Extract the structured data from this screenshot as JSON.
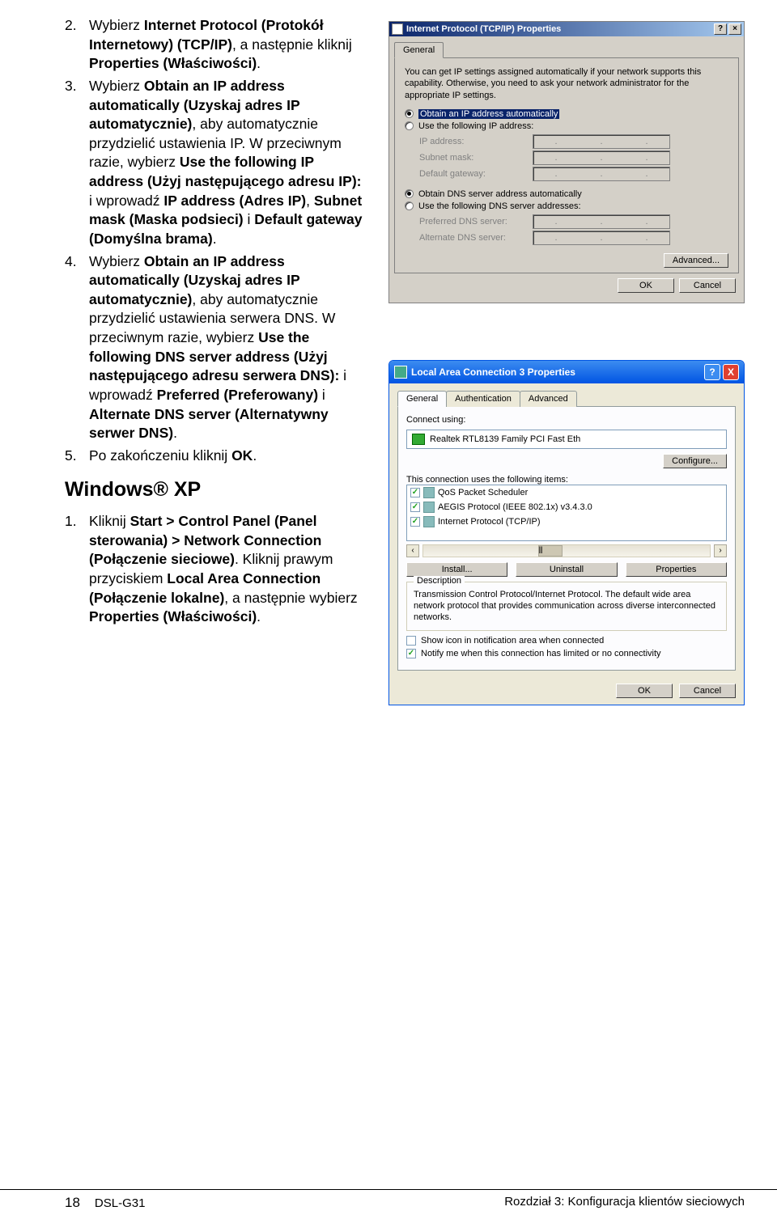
{
  "list1": {
    "item2": {
      "t1": "Wybierz ",
      "b1": "Internet Protocol (Protokół Internetowy) (TCP/IP)",
      "t2": ", a następnie kliknij ",
      "b2": "Properties (Właściwości)",
      "t3": "."
    },
    "item3": {
      "t1": "Wybierz ",
      "b1": "Obtain an IP address automatically (Uzyskaj adres IP automatycznie)",
      "t2": ", aby automatycznie przydzielić ustawienia IP. W przeciwnym razie, wybierz ",
      "b2": "Use the following IP address (Użyj następującego adresu IP):",
      "t3": " i wprowadź ",
      "b3": "IP address (Adres IP)",
      "t4": ", ",
      "b4": "Subnet mask (Maska podsieci)",
      "t5": " i ",
      "b5": "Default gateway (Domyślna brama)",
      "t6": "."
    },
    "item4": {
      "t1": "Wybierz ",
      "b1": "Obtain an IP address automatically (Uzyskaj adres IP automatycznie)",
      "t2": ", aby automatycznie przydzielić ustawienia serwera DNS. W przeciwnym razie, wybierz ",
      "b2": "Use the following DNS server address (Użyj następującego adresu serwera DNS):",
      "t3": " i wprowadź ",
      "b3": "Preferred (Preferowany)",
      "t4": " i ",
      "b4": "Alternate DNS server (Alternatywny serwer DNS)",
      "t5": "."
    },
    "item5": {
      "t1": "Po zakończeniu kliknij ",
      "b1": "OK",
      "t2": "."
    }
  },
  "header2": "Windows® XP",
  "list2": {
    "item1": {
      "t1": "Kliknij ",
      "b1": "Start > Control Panel (Panel sterowania) > Network Connection (Połączenie sieciowe)",
      "t2": ". Kliknij prawym przyciskiem ",
      "b2": "Local Area Connection (Połączenie lokalne)",
      "t3": ", a następnie wybierz ",
      "b3": "Properties (Właściwości)",
      "t4": "."
    }
  },
  "dlg1": {
    "title": "Internet Protocol (TCP/IP) Properties",
    "help": "?",
    "close": "×",
    "tab_general": "General",
    "intro": "You can get IP settings assigned automatically if your network supports this capability. Otherwise, you need to ask your network administrator for the appropriate IP settings.",
    "r1": "Obtain an IP address automatically",
    "r2": "Use the following IP address:",
    "f_ip": "IP address:",
    "f_subnet": "Subnet mask:",
    "f_gateway": "Default gateway:",
    "r3": "Obtain DNS server address automatically",
    "r4": "Use the following DNS server addresses:",
    "f_pref": "Preferred DNS server:",
    "f_alt": "Alternate DNS server:",
    "advanced": "Advanced...",
    "ok": "OK",
    "cancel": "Cancel"
  },
  "dlg2": {
    "title": "Local Area Connection 3 Properties",
    "help": "?",
    "close": "X",
    "tab_general": "General",
    "tab_auth": "Authentication",
    "tab_adv": "Advanced",
    "connect_using": "Connect using:",
    "nic": "Realtek RTL8139 Family PCI Fast Eth",
    "configure": "Configure...",
    "uses_items": "This connection uses the following items:",
    "it1": "QoS Packet Scheduler",
    "it2": "AEGIS Protocol (IEEE 802.1x) v3.4.3.0",
    "it3": "Internet Protocol (TCP/IP)",
    "scroll_l": "‹",
    "scroll_r": "›",
    "scroll_mid": "⦀",
    "install": "Install...",
    "uninstall": "Uninstall",
    "properties": "Properties",
    "desc_legend": "Description",
    "desc_text": "Transmission Control Protocol/Internet Protocol. The default wide area network protocol that provides communication across diverse interconnected networks.",
    "chk1": "Show icon in notification area when connected",
    "chk2": "Notify me when this connection has limited or no connectivity",
    "ok": "OK",
    "cancel": "Cancel"
  },
  "footer": {
    "page": "18",
    "model": "DSL-G31",
    "chapter": "Rozdział 3: Konfiguracja klientów sieciowych"
  }
}
